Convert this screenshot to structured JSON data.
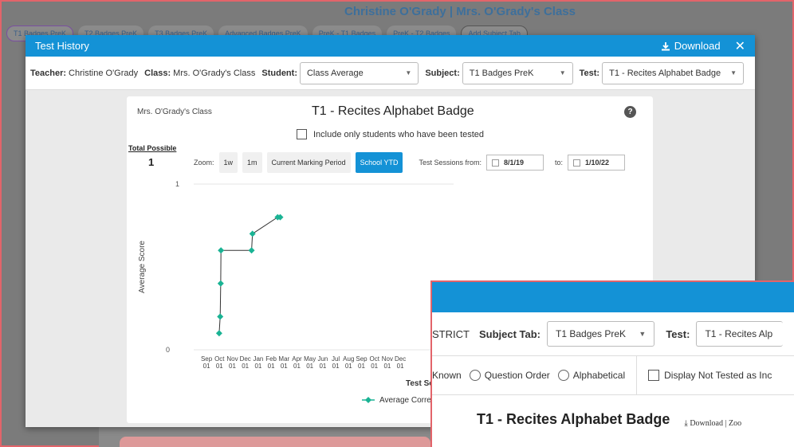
{
  "background": {
    "title": "Christine O'Grady | Mrs. O'Grady's Class",
    "tabs": [
      "T1 Badges PreK",
      "T2 Badges PreK",
      "T3 Badges PreK",
      "Advanced Badges PreK",
      "PreK - T1 Badges",
      "PreK - T2 Badges",
      "Add Subject Tab"
    ]
  },
  "modal": {
    "title": "Test History",
    "download_label": "Download",
    "close_glyph": "✕",
    "filters": {
      "teacher_label": "Teacher:",
      "teacher_value": "Christine O'Grady",
      "class_label": "Class:",
      "class_value": "Mrs. O'Grady's Class",
      "student_label": "Student:",
      "student_value": "Class Average",
      "subject_label": "Subject:",
      "subject_value": "T1 Badges PreK",
      "test_label": "Test:",
      "test_value": "T1 - Recites Alphabet Badge"
    }
  },
  "card": {
    "class_name": "Mrs. O'Grady's Class",
    "title": "T1 - Recites Alphabet Badge",
    "checkbox_label": "Include only students who have been tested",
    "total_possible_label": "Total Possible",
    "total_possible_value": "1",
    "zoom_label": "Zoom:",
    "zoom_buttons": [
      "1w",
      "1m",
      "Current Marking Period",
      "School YTD"
    ],
    "sessions_label": "Test Sessions from:",
    "from_date": "8/1/19",
    "to_label": "to:",
    "to_date": "1/10/22"
  },
  "chart_data": {
    "type": "line",
    "ylabel": "Average Score",
    "xlabel": "Test Session Da",
    "ylim": [
      0,
      1
    ],
    "y_ticks": [
      "1",
      "0"
    ],
    "x_ticks": [
      [
        "Sep",
        "01"
      ],
      [
        "Oct",
        "01"
      ],
      [
        "Nov",
        "01"
      ],
      [
        "Dec",
        "01"
      ],
      [
        "Jan",
        "01"
      ],
      [
        "Feb",
        "01"
      ],
      [
        "Mar",
        "01"
      ],
      [
        "Apr",
        "01"
      ],
      [
        "May",
        "01"
      ],
      [
        "Jun",
        "01"
      ],
      [
        "Jul",
        "01"
      ],
      [
        "Aug",
        "01"
      ],
      [
        "Sep",
        "01"
      ],
      [
        "Oct",
        "01"
      ],
      [
        "Nov",
        "01"
      ],
      [
        "Dec",
        "01"
      ]
    ],
    "series": [
      {
        "name": "Average Correct",
        "color": "#1ab394",
        "x": [
          1.97,
          2.05,
          2.09,
          2.11,
          4.48,
          4.55,
          6.5,
          6.7
        ],
        "y": [
          0.1,
          0.2,
          0.4,
          0.6,
          0.6,
          0.7,
          0.8,
          0.8
        ]
      }
    ],
    "grid": true,
    "legend": "bottom-right"
  },
  "modal2": {
    "district_fragment": "STRICT",
    "subject_tab_label": "Subject Tab:",
    "subject_tab_value": "T1 Badges PreK",
    "test_label": "Test:",
    "test_value": "T1 - Recites Alp",
    "known_fragment": "Known",
    "radio_question_order": "Question Order",
    "radio_alphabetical": "Alphabetical",
    "display_not_tested": "Display Not Tested as Inc",
    "title": "T1 - Recites Alphabet Badge",
    "download_zoom": "Download | Zoo"
  }
}
